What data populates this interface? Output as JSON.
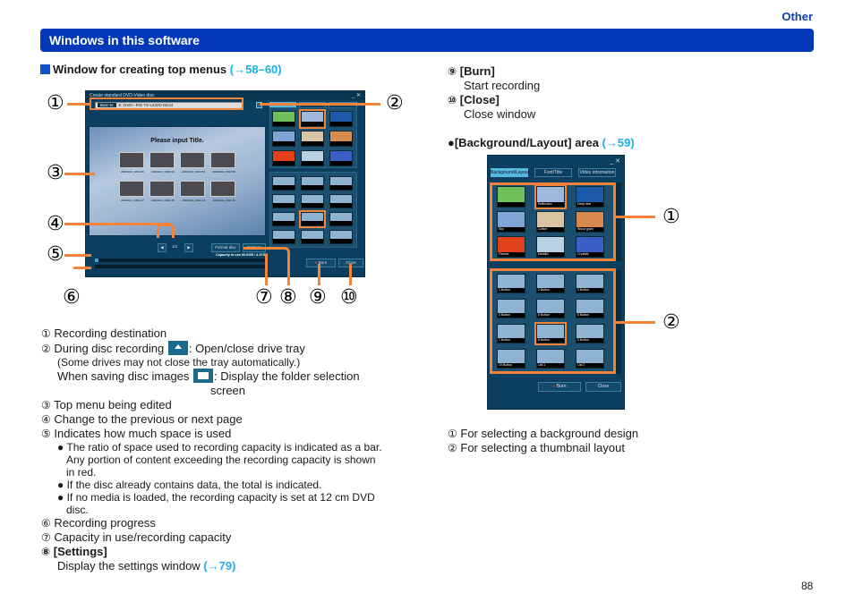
{
  "header": {
    "section": "Other",
    "title": "Windows in this software"
  },
  "left": {
    "heading": "Window for creating top menus",
    "heading_link": "(→58–60)",
    "window": {
      "title": "Create standard DVD-Video disc",
      "burn_to_label": "Burn to",
      "burn_to_value": "E: DVD+-RW TS-L632D DE34",
      "preview_title": "Please input Title.",
      "thumb_captions": [
        "20060411_0632 08",
        "20060417_0006 03",
        "20060417_2344 50",
        "20060411_0700 58",
        "20060417_0552 27",
        "20060417_0606 35",
        "20060411_0632 24",
        "20060411_0700 11"
      ],
      "page_indicator": "1/1",
      "format_disc": "Format disc",
      "settings": "Settings",
      "capacity": "Capacity in use 00.0GB / 4.37GB",
      "burn": "Burn",
      "close": "Close",
      "progress_used": 0.02
    },
    "callouts": [
      "①",
      "②",
      "③",
      "④",
      "⑤",
      "⑥",
      "⑦",
      "⑧",
      "⑨",
      "⑩"
    ],
    "items": [
      {
        "n": "①",
        "text": "Recording destination"
      },
      {
        "n": "②",
        "text": "During disc recording",
        "text2": ": Open/close drive tray"
      },
      {
        "text": "(Some drives may not close the tray automatically.)"
      },
      {
        "text": "When saving disc images",
        "text2": ": Display the folder selection"
      },
      {
        "text": "screen"
      },
      {
        "n": "③",
        "text": "Top menu being edited"
      },
      {
        "n": "④",
        "text": "Change to the previous or next page"
      },
      {
        "n": "⑤",
        "text": "Indicates how much space is used"
      },
      {
        "text": "● The ratio of space used to recording capacity is indicated as a bar."
      },
      {
        "text": "Any portion of content exceeding the recording capacity is shown"
      },
      {
        "text": "in red."
      },
      {
        "text": "● If the disc already contains data, the total is indicated."
      },
      {
        "text": "● If no media is loaded, the recording capacity is set at 12 cm DVD"
      },
      {
        "text": "disc."
      },
      {
        "n": "⑥",
        "text": "Recording progress"
      },
      {
        "n": "⑦",
        "text": "Capacity in use/recording capacity"
      },
      {
        "n": "⑧",
        "text": "[Settings]"
      },
      {
        "text": "Display the settings window",
        "link": "(→79)"
      }
    ]
  },
  "right": {
    "items": [
      {
        "n": "⑨",
        "text": "[Burn]"
      },
      {
        "text": "Start recording"
      },
      {
        "n": "⑩",
        "text": "[Close]"
      },
      {
        "text": "Close window"
      }
    ],
    "heading": "●[Background/Layout] area",
    "heading_link": "(→59)",
    "panel": {
      "tabs": [
        "Background/Layout",
        "Font/Title",
        "Video information"
      ],
      "backgrounds": [
        "",
        "Reflection",
        "Deep sea",
        "Sky",
        "Cotton",
        "Wood grain",
        "Flames",
        "Metallic",
        "Crystals"
      ],
      "layouts": [
        "1 Button",
        "2 Button",
        "3 Button",
        "4 Button",
        "5 Button",
        "6 Button",
        "7 Button",
        "8 Button",
        "9 Button",
        "10 Button",
        "List 1",
        "List 2"
      ],
      "burn": "Burn",
      "close": "Close"
    },
    "legend": [
      {
        "n": "①",
        "text": "For selecting a background design"
      },
      {
        "n": "②",
        "text": "For selecting a thumbnail layout"
      }
    ]
  },
  "page_number": "88"
}
